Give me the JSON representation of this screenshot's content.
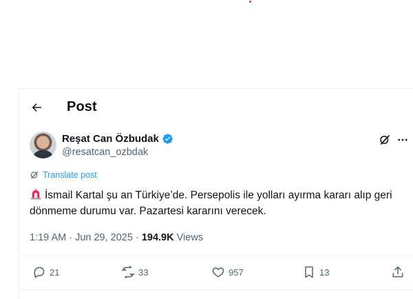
{
  "header": {
    "title": "Post"
  },
  "author": {
    "display_name": "Reşat Can Özbudak",
    "handle": "@resatcan_ozbdak",
    "verified": true
  },
  "post": {
    "translate_label": "Translate post",
    "emoji": "siren",
    "text": "İsmail Kartal şu an Türkiye’de. Persepolis ile yolları ayırma kararı alıp geri dönmeme durumu var. Pazartesi kararını verecek.",
    "timestamp": "1:19 AM · Jun 29, 2025 ·",
    "views_count": "194.9K",
    "views_label": "Views"
  },
  "actions": {
    "replies": "21",
    "reposts": "33",
    "likes": "957",
    "bookmarks": "13"
  },
  "colors": {
    "accent": "#1d9bf0",
    "secondary_text": "#536471",
    "primary_text": "#0f1419"
  }
}
